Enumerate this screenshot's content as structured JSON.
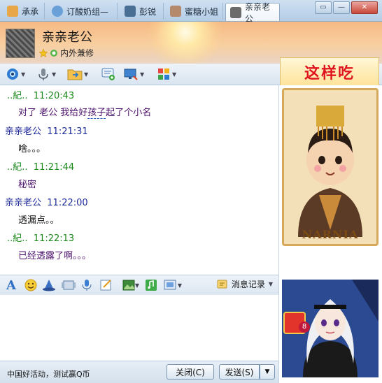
{
  "tabs": [
    {
      "label": "承承",
      "active": false,
      "color": "#e8a84a"
    },
    {
      "label": "订酸奶组—",
      "active": false,
      "color": "#6aa0d8"
    },
    {
      "label": "彭锐",
      "active": false,
      "color": "#4a6f95"
    },
    {
      "label": "蜜糖小姐",
      "active": false,
      "color": "#b58a6c"
    },
    {
      "label": "亲亲老公",
      "active": true,
      "color": "#6b6b6b"
    }
  ],
  "window_buttons": {
    "restore": "▭",
    "minimize": "—",
    "close": "✕"
  },
  "contact": {
    "name": "亲亲老公",
    "signature": "内外兼修"
  },
  "toolbar_icons": [
    "video-icon",
    "voice-icon",
    "file-transfer-icon",
    "sms-icon",
    "screen-share-icon",
    "apps-icon"
  ],
  "ad": {
    "text": "这样吃"
  },
  "messages": [
    {
      "sender": "..紀..",
      "time": "11:20:43",
      "text_before": "对了 老公 我给好",
      "text_link": "孩子",
      "text_after": "起了个小名",
      "mine": true
    },
    {
      "sender": "亲亲老公",
      "time": "11:21:31",
      "text": "啥。。。",
      "mine": false
    },
    {
      "sender": "..紀..",
      "time": "11:21:44",
      "text": "秘密",
      "mine": true
    },
    {
      "sender": "亲亲老公",
      "time": "11:22:00",
      "text": "透漏点。。",
      "mine": false
    },
    {
      "sender": "..紀..",
      "time": "11:22:13",
      "text": "已经透露了啊。。。",
      "mine": true
    }
  ],
  "input_toolbar": {
    "icons": [
      "font-icon",
      "emoticon-icon",
      "magic-icon",
      "shake-icon",
      "voice-message-icon",
      "scribble-icon",
      "screenshot-icon",
      "music-icon",
      "image-icon"
    ],
    "history_label": "消息记录"
  },
  "input": {
    "value": "",
    "placeholder": ""
  },
  "bottom": {
    "promo": "中国好活动，测试赢Q币",
    "close_label": "关闭(C)",
    "send_label": "发送(S)"
  },
  "portrait": {
    "caption": "NARNIA",
    "badge": "8"
  }
}
